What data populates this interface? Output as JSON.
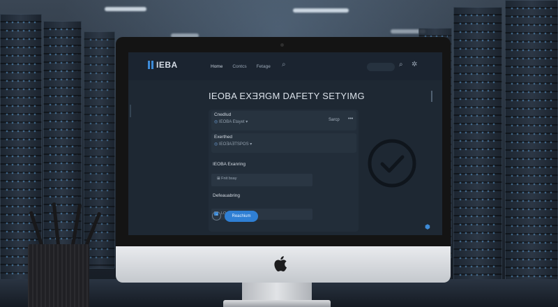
{
  "app": {
    "logo_text": "IEBA",
    "page_title": "IEOBA EXƎЯGM DAFETY SETYIMG"
  },
  "nav": {
    "items": [
      {
        "label": "Home",
        "active": true
      },
      {
        "label": "Contcs",
        "active": false
      },
      {
        "label": "Fetage",
        "active": false
      }
    ]
  },
  "cards": [
    {
      "title": "Cnedlud",
      "sub": "IEOBA Etayet",
      "action": "Sarcp",
      "more": "•••"
    },
    {
      "title": "Exerthed",
      "sub": "IEOƎAƎTSPOS",
      "action": "",
      "more": ""
    }
  ],
  "sections": {
    "examinig": {
      "title": "IEOBA Exanring",
      "field": "Fnit bsay"
    },
    "defaults": {
      "title": "Defeauabring",
      "field": "LOvrtg  Isle"
    }
  },
  "buttons": {
    "primary": "Reachium"
  },
  "colors": {
    "accent": "#3d8bd8",
    "screen_bg": "#1e2833",
    "panel_bg": "#222d39"
  },
  "icons": [
    "search-icon",
    "gear-icon",
    "checkmark-circle-icon",
    "shield-icon",
    "apple-logo-icon"
  ]
}
